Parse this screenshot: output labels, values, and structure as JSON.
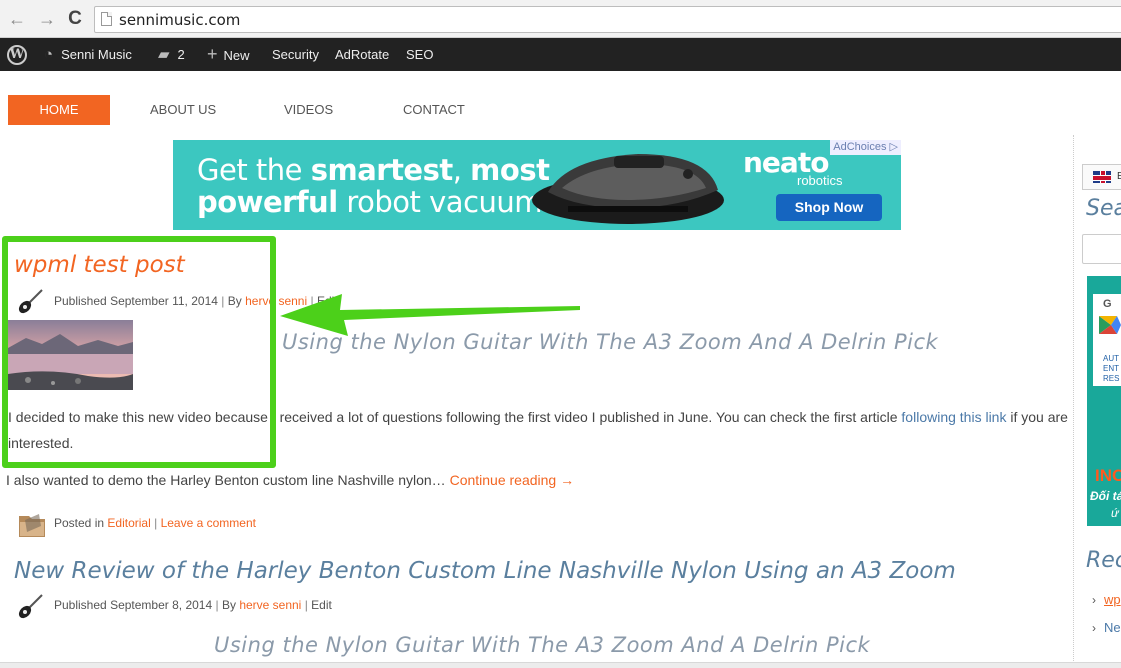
{
  "browser": {
    "back": "←",
    "forward": "→",
    "reload": "C",
    "url": "sennimusic.com"
  },
  "admin_bar": {
    "site_name": "Senni Music",
    "comments_count": "2",
    "new_label": "New",
    "security_label": "Security",
    "adrotate_label": "AdRotate",
    "seo_label": "SEO"
  },
  "nav": {
    "items": [
      "HOME",
      "ABOUT US",
      "VIDEOS",
      "CONTACT"
    ],
    "active_color": "#f26522"
  },
  "ad": {
    "line1_pre": "Get the ",
    "line1_bold": "smartest",
    "line1_mid": ", ",
    "line1_bold2": "most",
    "line2_bold": "powerful",
    "line2_post": " robot vacuum.",
    "brand": "neato",
    "brand_sub": "robotics",
    "button": "Shop Now",
    "adchoices": "AdChoices",
    "bg_color": "#3cc7c0"
  },
  "post1": {
    "title": "wpml test post",
    "published_prefix": "Published",
    "date": "September 11, 2014",
    "by_prefix": "By",
    "author": "herve senni",
    "edit": "Edit",
    "subheading": "Using the Nylon Guitar With The A3 Zoom And A Delrin Pick",
    "para1_a": "I decided to make this new video because I received a lot of questions following the first video I published in June. You can check the first article ",
    "para1_link": "following this link",
    "para1_b": " if you are",
    "para1_c": "interested.",
    "para2": "I also wanted to demo the Harley Benton custom line Nashville nylon… ",
    "continue": "Continue reading →",
    "posted_in_prefix": "Posted in",
    "category": "Editorial",
    "leave_comment": "Leave a comment"
  },
  "post2": {
    "title": "New Review of the Harley Benton Custom Line Nashville Nylon Using an A3 Zoom",
    "published_prefix": "Published",
    "date": "September 8, 2014",
    "by_prefix": "By",
    "author": "herve senni",
    "edit": "Edit",
    "subheading": "Using the Nylon Guitar With The A3 Zoom And A Delrin Pick"
  },
  "sidebar": {
    "lang_code": "E",
    "search_heading": "Sea",
    "ad_top": "G",
    "ad_small": "AUT ENT RES",
    "ad_inc": "INC",
    "ad_line1": "Đối tá",
    "ad_line2": "ứ",
    "recent_heading": "Rec",
    "recent_items": [
      "wp",
      "Ne"
    ]
  },
  "highlight_color": "#4cd01a"
}
